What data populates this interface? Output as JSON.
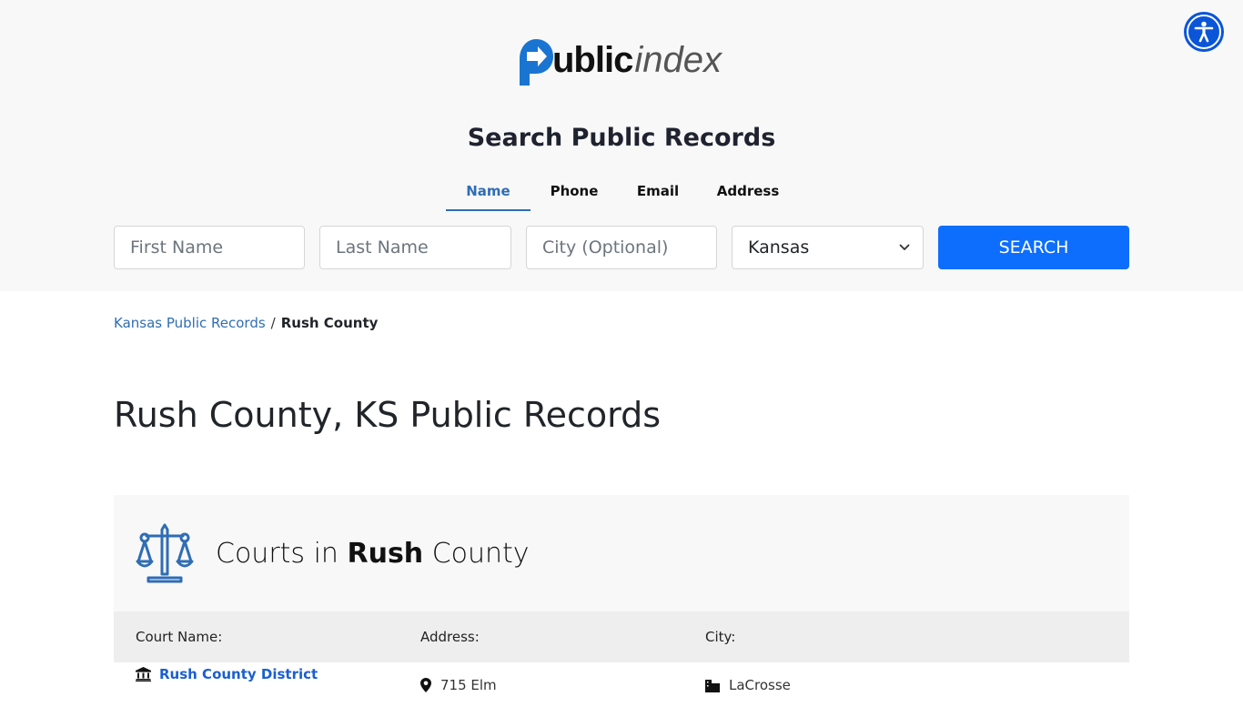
{
  "header": {
    "logo_bold": "ublic",
    "logo_light": "index",
    "accessibility_label": "Accessibility"
  },
  "search": {
    "title": "Search Public Records",
    "tabs": [
      {
        "label": "Name",
        "active": true
      },
      {
        "label": "Phone",
        "active": false
      },
      {
        "label": "Email",
        "active": false
      },
      {
        "label": "Address",
        "active": false
      }
    ],
    "first_name_placeholder": "First Name",
    "last_name_placeholder": "Last Name",
    "city_placeholder": "City (Optional)",
    "state_selected": "Kansas",
    "button_label": "SEARCH"
  },
  "breadcrumb": {
    "parent": "Kansas Public Records",
    "separator": "/",
    "current": "Rush County"
  },
  "page": {
    "title": "Rush County, KS Public Records"
  },
  "courts": {
    "title_prefix": "Courts in",
    "title_bold": "Rush",
    "title_suffix": "County",
    "columns": [
      "Court Name:",
      "Address:",
      "City:"
    ],
    "rows": [
      {
        "name": "Rush County District",
        "address": "715 Elm",
        "city": "LaCrosse"
      }
    ]
  },
  "colors": {
    "brand_blue": "#1a75d2",
    "primary_button": "#0d6efd",
    "link": "#2f6db5",
    "accessibility": "#0a55d8"
  }
}
